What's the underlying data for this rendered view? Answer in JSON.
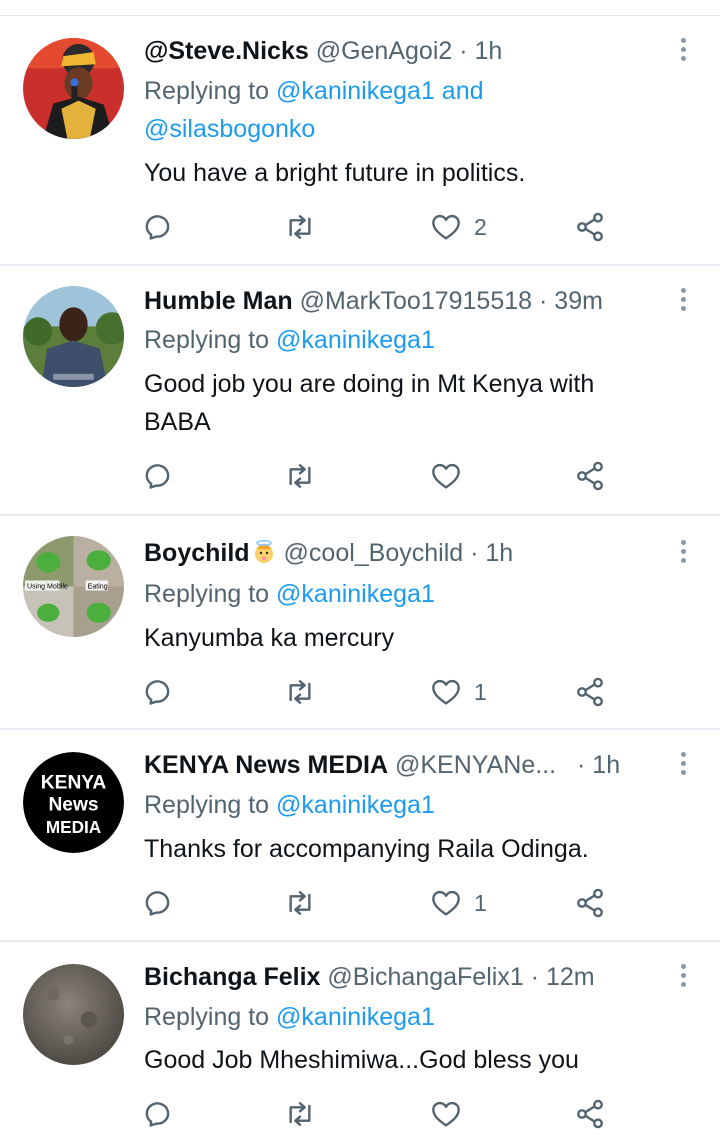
{
  "colors": {
    "link": "#1d9bf0",
    "muted": "#536471",
    "text": "#0f1419",
    "divider": "#e6ecf0"
  },
  "tweets": [
    {
      "name": "@Steve.Nicks",
      "handle": "@GenAgoi2",
      "time": "· 1h",
      "replying_prefix": "Replying to",
      "mentions": "@kaninikega1 and",
      "mentions2": "@silasbogonko",
      "text": "You have a bright future in politics.",
      "likes": "2",
      "avatar": "red-backdrop-speaker"
    },
    {
      "name": "Humble Man",
      "handle": "@MarkToo17915518",
      "time": "· 39m",
      "replying_prefix": "Replying to",
      "mentions": "@kaninikega1",
      "text_line1": "Good job you are doing in Mt Kenya with",
      "text_line2": "BABA",
      "likes": "",
      "avatar": "man-outdoors"
    },
    {
      "name": "Boychild",
      "name_emoji": "baby-angel-emoji",
      "handle": "@cool_Boychild",
      "time": "· 1h",
      "replying_prefix": "Replying to",
      "mentions": "@kaninikega1",
      "text": "Kanyumba ka mercury",
      "likes": "1",
      "avatar_labels": [
        "Using Mobile",
        "Eating"
      ]
    },
    {
      "name": "KENYA News MEDIA",
      "handle": "@KENYANe...",
      "time": "· 1h",
      "replying_prefix": "Replying to",
      "mentions": "@kaninikega1",
      "text": "Thanks for accompanying Raila Odinga.",
      "likes": "1",
      "avatar_logo": [
        "KENYA",
        "News",
        "MEDIA"
      ]
    },
    {
      "name": "Bichanga Felix",
      "handle": "@BichangaFelix1",
      "time": "· 12m",
      "replying_prefix": "Replying to",
      "mentions": "@kaninikega1",
      "text": "Good Job Mheshimiwa...God bless you",
      "likes": "",
      "avatar": "grey-texture"
    }
  ]
}
